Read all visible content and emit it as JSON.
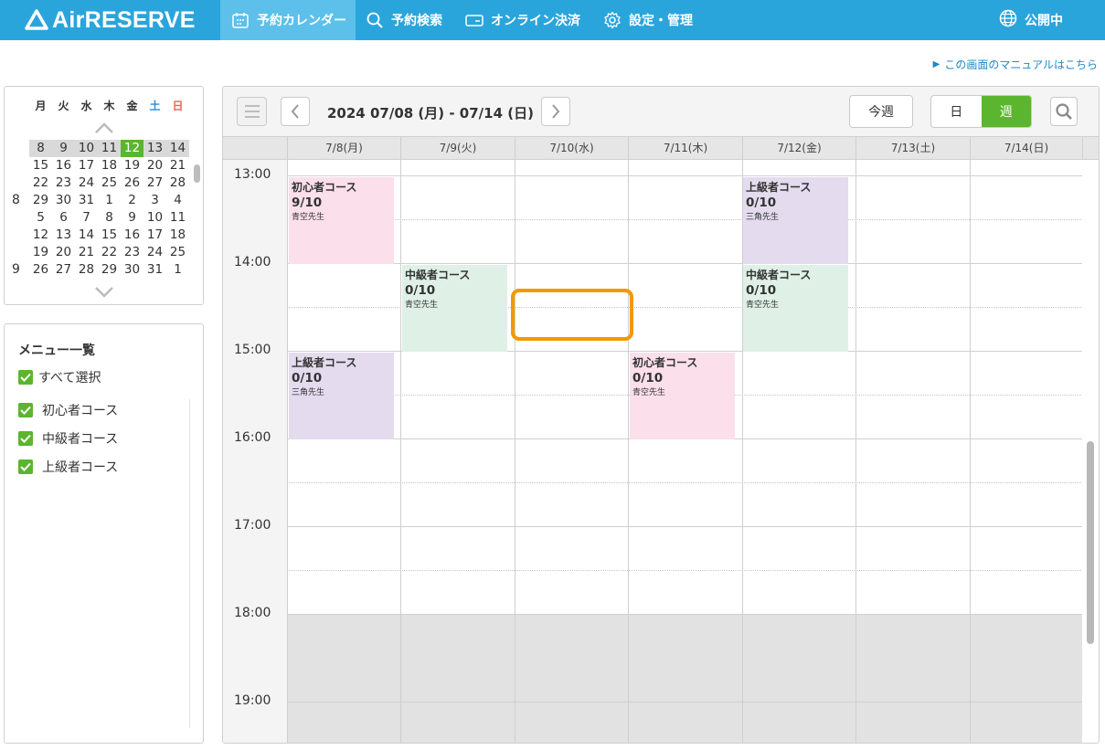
{
  "header": {
    "logo": "AirRESERVE",
    "nav": [
      {
        "label": "予約カレンダー",
        "icon": "calendar-icon",
        "active": true
      },
      {
        "label": "予約検索",
        "icon": "search-icon",
        "active": false
      },
      {
        "label": "オンライン決済",
        "icon": "wallet-icon",
        "active": false
      },
      {
        "label": "設定・管理",
        "icon": "gear-icon",
        "active": false
      }
    ],
    "status": "公開中",
    "status_icon": "globe-icon"
  },
  "manual_link": "この画面のマニュアルはこちら",
  "mini_calendar": {
    "weekdays": [
      "月",
      "火",
      "水",
      "木",
      "金",
      "土",
      "日"
    ],
    "rows": [
      [
        "8",
        "9",
        "10",
        "11",
        "12",
        "13",
        "14"
      ],
      [
        "15",
        "16",
        "17",
        "18",
        "19",
        "20",
        "21"
      ],
      [
        "22",
        "23",
        "24",
        "25",
        "26",
        "27",
        "28"
      ],
      [
        "29",
        "30",
        "31",
        "1",
        "2",
        "3",
        "4"
      ],
      [
        "5",
        "6",
        "7",
        "8",
        "9",
        "10",
        "11"
      ],
      [
        "12",
        "13",
        "14",
        "15",
        "16",
        "17",
        "18"
      ],
      [
        "19",
        "20",
        "21",
        "22",
        "23",
        "24",
        "25"
      ],
      [
        "26",
        "27",
        "28",
        "29",
        "30",
        "31",
        "1"
      ]
    ],
    "month_labels": [
      "8",
      "9"
    ],
    "today": "12"
  },
  "menu": {
    "title": "メニュー一覧",
    "select_all": "すべて選択",
    "items": [
      "初心者コース",
      "中級者コース",
      "上級者コース"
    ]
  },
  "toolbar": {
    "date_range": "2024 07/08 (月) - 07/14 (日)",
    "this_week": "今週",
    "view_day": "日",
    "view_week": "週",
    "active_view": "週"
  },
  "days": [
    "7/8(月)",
    "7/9(火)",
    "7/10(水)",
    "7/11(木)",
    "7/12(金)",
    "7/13(土)",
    "7/14(日)"
  ],
  "times": [
    "13:00",
    "14:00",
    "15:00",
    "16:00",
    "17:00",
    "18:00",
    "19:00"
  ],
  "events": [
    {
      "name": "初心者コース",
      "count": "9/10",
      "teacher": "青空先生",
      "color": "#fbdfea"
    },
    {
      "name": "上級者コース",
      "count": "0/10",
      "teacher": "三角先生",
      "color": "#e4dbee"
    },
    {
      "name": "中級者コース",
      "count": "0/10",
      "teacher": "青空先生",
      "color": "#dff0e7"
    },
    {
      "name": "中級者コース",
      "count": "0/10",
      "teacher": "青空先生",
      "color": "#dff0e7"
    },
    {
      "name": "上級者コース",
      "count": "0/10",
      "teacher": "三角先生",
      "color": "#e4dbee"
    },
    {
      "name": "初心者コース",
      "count": "0/10",
      "teacher": "青空先生",
      "color": "#fbdfea"
    }
  ],
  "colors": {
    "header": "#2aa5dc",
    "accent_green": "#5bb52f",
    "highlight": "#f39800"
  }
}
